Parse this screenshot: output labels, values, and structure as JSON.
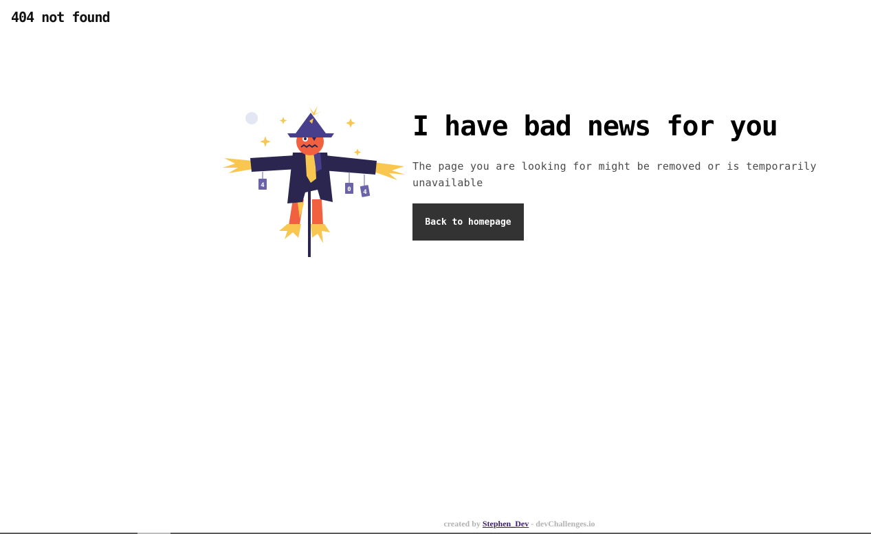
{
  "header": {
    "brand": "404 not found"
  },
  "illustration": {
    "can_labels": [
      "4",
      "0",
      "4"
    ],
    "colors": {
      "hat": "#473f8c",
      "coat": "#2a2650",
      "face": "#f2613f",
      "straw": "#f9c74f",
      "pole": "#2a2650",
      "moon": "#e3e6f3"
    }
  },
  "main": {
    "headline": "I have bad news for you",
    "message": "The page you are looking for might be removed or is temporarily unavailable",
    "back_button_label": "Back to homepage"
  },
  "footer": {
    "prefix": "created by ",
    "author": "Stephen_Dev",
    "suffix": " - devChallenges.io"
  }
}
